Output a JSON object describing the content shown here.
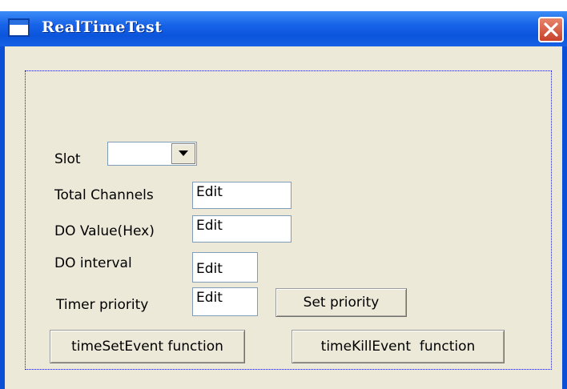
{
  "window": {
    "title": "RealTimeTest",
    "close_label": "Close"
  },
  "colors": {
    "titlebar": "#0b55dc",
    "client_bg": "#ece9d8",
    "group_border": "#1a1ae0",
    "close_button": "#c7412b"
  },
  "form": {
    "slot": {
      "label": "Slot",
      "value": ""
    },
    "total_channels": {
      "label": "Total Channels",
      "value": "Edit"
    },
    "do_value": {
      "label": "DO Value(Hex)",
      "value": "Edit"
    },
    "do_interval": {
      "label": "DO interval",
      "value": "Edit"
    },
    "timer_priority": {
      "label": "Timer priority",
      "value": "Edit"
    }
  },
  "buttons": {
    "set_priority": "Set priority",
    "time_set_event": "timeSetEvent function",
    "time_kill_event": "timeKillEvent  function"
  },
  "icons": {
    "app": "window-icon",
    "close": "close-icon",
    "dropdown": "chevron-down-icon"
  }
}
